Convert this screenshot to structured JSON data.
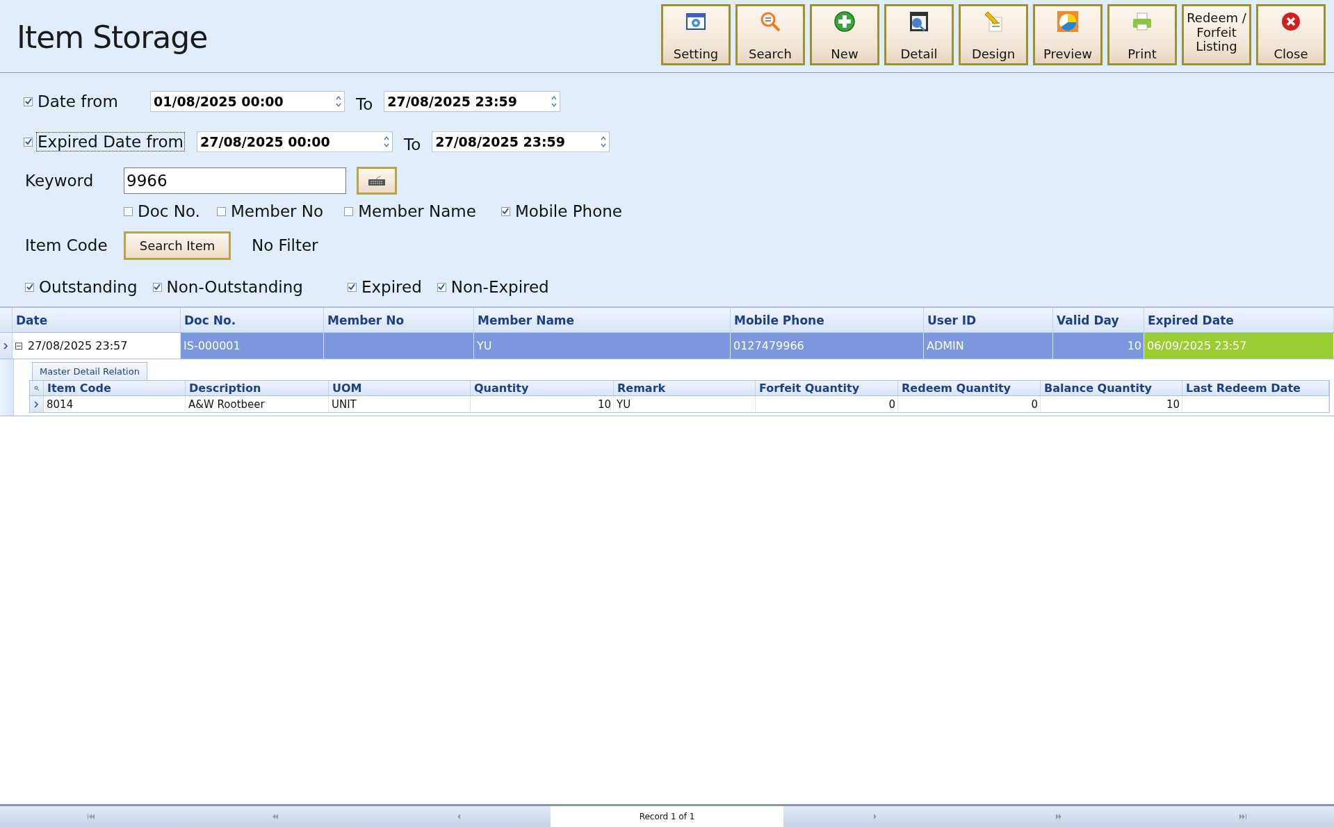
{
  "window": {
    "title": "Item Storage"
  },
  "toolbar": [
    {
      "label": "Setting",
      "kind": "gear"
    },
    {
      "label": "Search",
      "kind": "magnifier"
    },
    {
      "label": "New",
      "kind": "plus"
    },
    {
      "label": "Detail",
      "kind": "document"
    },
    {
      "label": "Design",
      "kind": "pencil"
    },
    {
      "label": "Preview",
      "kind": "chart"
    },
    {
      "label": "Print",
      "kind": "printer"
    },
    {
      "label": "Redeem / Forfeit Listing",
      "kind": "text"
    },
    {
      "label": "Close",
      "kind": "close"
    }
  ],
  "filters": {
    "date_range": {
      "label": "Date from",
      "checked": true,
      "focused": false,
      "from": "01/08/2025 00:00",
      "to_label": "To",
      "to": "27/08/2025 23:59"
    },
    "expired_range": {
      "label": "Expired Date from",
      "checked": true,
      "focused": true,
      "from": "27/08/2025 00:00",
      "to_label": "To",
      "to": "27/08/2025 23:59"
    },
    "keyword": {
      "label": "Keyword",
      "value": "9966"
    },
    "search_in": [
      {
        "label": "Doc No.",
        "checked": false
      },
      {
        "label": "Member No",
        "checked": false
      },
      {
        "label": "Member Name",
        "checked": false
      },
      {
        "label": "Mobile Phone",
        "checked": true
      }
    ],
    "item_code": {
      "label": "Item Code",
      "button": "Search Item",
      "filter_text": "No Filter"
    },
    "outstanding_filters": [
      {
        "label": "Outstanding",
        "checked": true
      },
      {
        "label": "Non-Outstanding",
        "checked": true
      }
    ],
    "expiry_filters": [
      {
        "label": "Expired",
        "checked": true
      },
      {
        "label": "Non-Expired",
        "checked": true
      }
    ]
  },
  "grid": {
    "columns": [
      {
        "label": "Date",
        "kind": "text"
      },
      {
        "label": "Doc No.",
        "kind": "text"
      },
      {
        "label": "Member No",
        "kind": "text"
      },
      {
        "label": "Member Name",
        "kind": "text"
      },
      {
        "label": "Mobile Phone",
        "kind": "text"
      },
      {
        "label": "User ID",
        "kind": "text"
      },
      {
        "label": "Valid Day",
        "kind": "number"
      },
      {
        "label": "Expired Date",
        "kind": "text"
      }
    ],
    "rows": [
      {
        "selected": true,
        "expanded": true,
        "color": "#9acd32",
        "cells": [
          "27/08/2025 23:57",
          "IS-000001",
          "",
          "YU",
          "0127479966",
          "ADMIN",
          "10",
          "06/09/2025 23:57"
        ],
        "detail": {
          "tab": "Master Detail Relation",
          "columns": [
            {
              "label": "Item Code",
              "kind": "text"
            },
            {
              "label": "Description",
              "kind": "text"
            },
            {
              "label": "UOM",
              "kind": "text"
            },
            {
              "label": "Quantity",
              "kind": "number"
            },
            {
              "label": "Remark",
              "kind": "text"
            },
            {
              "label": "Forfeit Quantity",
              "kind": "number"
            },
            {
              "label": "Redeem Quantity",
              "kind": "number"
            },
            {
              "label": "Balance Quantity",
              "kind": "number"
            },
            {
              "label": "Last Redeem Date",
              "kind": "text"
            }
          ],
          "rows": [
            [
              "8014",
              "A&W Rootbeer",
              "UNIT",
              "10",
              "YU",
              "0",
              "0",
              "10",
              ""
            ]
          ]
        }
      }
    ]
  },
  "navigator": {
    "record_text": "Record 1 of 1"
  }
}
